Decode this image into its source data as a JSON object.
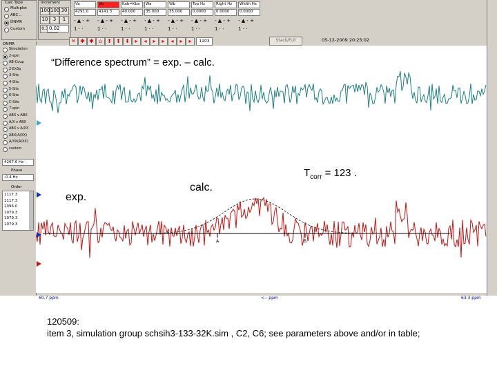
{
  "toolbar": {
    "calc_type_label": "Calc Type",
    "increment_label": "Increment",
    "options": [
      "Multiplet",
      "ABC...",
      "DNMR",
      "Custom"
    ],
    "selected_option": "DNMR",
    "increment_values": [
      "1000",
      "100",
      "30",
      "10",
      "3",
      "1",
      "0.3",
      "0.0",
      "0.02"
    ],
    "columns": [
      {
        "header": "Va",
        "value": "4291.0",
        "highlight": false
      },
      {
        "header": "Vb",
        "value": "4141.3",
        "highlight": true
      },
      {
        "header": "Kab=Kba",
        "value": "40.000",
        "highlight": false
      },
      {
        "header": "Wa",
        "value": "35.000",
        "highlight": false
      },
      {
        "header": "Wb",
        "value": "35.000",
        "highlight": false
      },
      {
        "header": "Top Hz",
        "value": "0.0000",
        "highlight": false
      },
      {
        "header": "Right Hz",
        "value": "0.0000",
        "highlight": false
      },
      {
        "header": "Width Hz",
        "value": "0.0000",
        "highlight": false
      }
    ],
    "step_value": "1",
    "counter": "1103",
    "stack_full_label": "Stack/Full",
    "datetime": "05-12-2009  20:25:02"
  },
  "left_panel": {
    "dnmr_label": "DNMR",
    "spin_options": [
      "Simulation",
      "2-spin",
      "AB-Coup",
      "2-Ex5p",
      "3-Sits",
      "4-Sits",
      "5-Sits",
      "6-Sits",
      "C-Sits",
      "7-spin",
      "ABX v ABX",
      "A/X v ABX",
      "ABX v A/XX",
      "ABX(A/XX)",
      "A/XX(A/XX)",
      "custom"
    ],
    "selected_spin": "2-spin",
    "freq_value": "4267.6 Hz",
    "phase_label": "Phase",
    "phase_value": "-0.4 Hz",
    "order_label": "Order",
    "order_values": [
      "1117.3",
      "1117.3",
      "1096.0",
      "1079.3",
      "1079.3",
      "1079.3"
    ]
  },
  "plot": {
    "left_ppm": "60.7 ppm",
    "center_ppm": "<-- ppm",
    "right_ppm": "63.3 ppm",
    "marker_a": "A",
    "marker_b": "B"
  },
  "slide": {
    "difference_title": "“Difference spectrum” = exp. – calc.",
    "exp_label": "exp.",
    "calc_label": "calc.",
    "tcorr_prefix": "T",
    "tcorr_sub": "corr",
    "tcorr_suffix": " = 123 .",
    "caption_line1": "120509:",
    "caption_line2": "item 3, simulation group schsih3-133-32K.sim ,  C2, C6; see parameters above and/or in table;"
  },
  "colors": {
    "difference_trace": "#1a7f7f",
    "experimental_trace": "#cc1111",
    "calc_curve": "#333333",
    "baseline": "#000000",
    "highlight_cell": "#ff2020",
    "ppm_label": "#0000aa"
  }
}
